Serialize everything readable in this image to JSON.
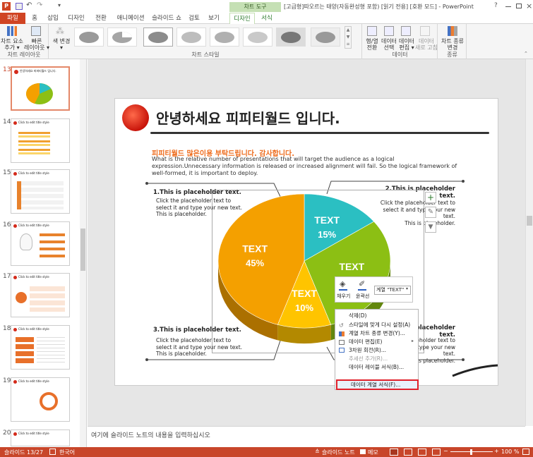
{
  "window": {
    "title": "[고급형]따오르는 태양(자동완성형 포함) [읽기 전용] [호환 모드] - PowerPoint",
    "tool_group": "차트 도구",
    "help": "?"
  },
  "ribbon_tabs": [
    "파일",
    "홈",
    "삽입",
    "디자인",
    "전환",
    "애니메이션",
    "슬라이드 쇼",
    "검토",
    "보기",
    "디자인",
    "서식"
  ],
  "ribbon": {
    "add_element": "차트 요소\n추가 ▾",
    "quick_layout": "빠른\n레이아웃 ▾",
    "change_color": "색 변경\n▾",
    "group_layout": "차트 레이아웃",
    "group_style": "차트 스타일",
    "switch_rowcol": "행/열\n전환",
    "select_data": "데이터\n선택",
    "edit_data": "데이터\n편집 ▾",
    "refresh_data": "데이터\n새로 고침",
    "group_data": "데이터",
    "change_type": "차트 종류\n변경",
    "group_type": "종류"
  },
  "slides": [
    {
      "num": "13",
      "title": "안녕하세요 피피티월드 입니다."
    },
    {
      "num": "14",
      "title": "Click to edit title style"
    },
    {
      "num": "15",
      "title": "Click to edit title style"
    },
    {
      "num": "16",
      "title": "Click to edit title style"
    },
    {
      "num": "17",
      "title": "Click to edit title style"
    },
    {
      "num": "18",
      "title": "Click to edit title style"
    },
    {
      "num": "19",
      "title": "Click to edit title style"
    },
    {
      "num": "20",
      "title": "Click to edit title style"
    }
  ],
  "slide": {
    "title": "안녕하세요 피피티월드 입니다.",
    "subtitle": "피피티월드 많은이용 부탁드립니다. 감사합니다.",
    "body": "What is the relative number of presentations that will target the audience as a logical expression.Unnecessary information is released or increased alignment will fail. So the logical framework of well-formed, it is important to deploy.",
    "blocks": [
      {
        "heading": "1.This is placeholder text.",
        "text": "Click the placeholder text to\nselect it and type your new text.\nThis is placeholder."
      },
      {
        "heading": "2.This is placeholder\ntext.",
        "text": "Click the placeholder text to\nselect it and type your new text.\nThis is placeholder."
      },
      {
        "heading": "3.This is placeholder text.",
        "text": "Click the placeholder text to\nselect it and type your new text.\nThis is placeholder."
      },
      {
        "heading": "4.This is placeholder\ntext.",
        "text": "Click the placeholder text to\nselect it and type your new text.\nThis is placeholder."
      }
    ]
  },
  "chart_data": {
    "type": "pie",
    "categories": [
      "TEXT",
      "TEXT",
      "TEXT",
      "TEXT"
    ],
    "values": [
      45,
      15,
      30,
      10
    ],
    "value_labels": [
      "45%",
      "15%",
      "30%",
      "10%"
    ],
    "colors": [
      "#f4a000",
      "#2bbfc2",
      "#8cbf14",
      "#ffc400"
    ]
  },
  "mini_toolbar": {
    "fill": "채우기",
    "outline": "윤곽선",
    "series_select": "계열 \"TEXT\""
  },
  "context_menu": [
    {
      "label": "삭제(D)",
      "disabled": false
    },
    {
      "label": "스타일에 맞게 다시 설정(A)",
      "disabled": false
    },
    {
      "label": "계열 차트 종류 변경(Y)...",
      "disabled": false
    },
    {
      "label": "데이터 편집(E)",
      "disabled": false
    },
    {
      "label": "3차원 회전(R)...",
      "disabled": false
    },
    {
      "label": "추세선 추가(R)...",
      "disabled": true
    },
    {
      "label": "데이터 레이블 서식(B)...",
      "disabled": false
    },
    {
      "label": "데이터 계열 서식(F)...",
      "disabled": false
    }
  ],
  "notes_placeholder": "여기에 슬라이드 노트의 내용을 입력하십시오",
  "status": {
    "slide_count": "슬라이드 13/27",
    "language": "한국어",
    "notes": "슬라이드 노트",
    "comments": "메모",
    "zoom": "100 %"
  }
}
